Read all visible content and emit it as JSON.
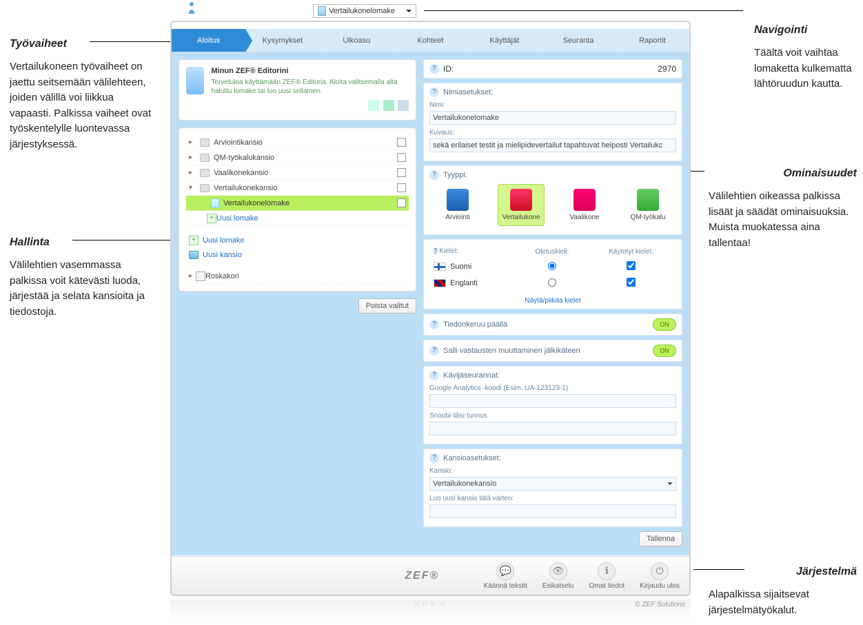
{
  "annotations": {
    "navigation": {
      "title": "Navigointi",
      "text": "Täältä voit vaihtaa lomaketta kulkematta lähtöruudun kautta."
    },
    "workphases": {
      "title": "Työvaiheet",
      "text": "Vertailukoneen työvaiheet on jaettu seitsemään välilehteen, joiden välillä voi liikkua vapaasti. Palkissa vaiheet ovat työskentelylle luontevassa järjestyksessä."
    },
    "management": {
      "title": "Hallinta",
      "text": "Välilehtien vasemmassa palkissa voit kätevästi luoda, järjestää ja selata kansioita ja tiedostoja."
    },
    "properties": {
      "title": "Ominaisuudet",
      "text": "Välilehtien oikeassa palkissa lisäät ja säädät ominaisuuksia. Muista muokatessa aina tallentaa!"
    },
    "system": {
      "title": "Järjestelmä",
      "text": "Alapalkissa sijaitsevat järjestelmätyökalut."
    }
  },
  "top_dropdown": "Vertailukonelomake",
  "tabs": [
    "Aloitus",
    "Kysymykset",
    "Ulkoasu",
    "Kohteet",
    "Käyttäjät",
    "Seuranta",
    "Raportit"
  ],
  "tabs_active_index": 0,
  "welcome": {
    "title": "Minun ZEF® Editorini",
    "text": "Tervetuloa käyttämään ZEF® Editoria. Aloita valitsemalla alta haluttu lomake tai luo uusi sellainen."
  },
  "tree": {
    "folders": [
      {
        "label": "Arviointikansio"
      },
      {
        "label": "QM-työkalukansio"
      },
      {
        "label": "Vaalikonekansio"
      },
      {
        "label": "Vertailukonekansio",
        "expanded": true,
        "children": [
          {
            "label": "Vertailukonelomake",
            "selected": true,
            "type": "file"
          },
          {
            "label": "Uusi lomake",
            "type": "new"
          }
        ]
      }
    ],
    "actions": {
      "new_form": "Uusi lomake",
      "new_folder": "Uusi kansio",
      "trash": "Roskakori"
    },
    "delete_selected": "Poista valitut"
  },
  "props": {
    "id_label": "ID:",
    "id_value": "2970",
    "name_settings": "Nimiasetukset:",
    "name_label": "Nimi:",
    "name_value": "Vertailukonelomake",
    "desc_label": "Kuvaus:",
    "desc_value": "sekä erilaiset testit ja mielipidevertailut tapahtuvat helposti Vertailukc",
    "type_label": "Tyyppi:",
    "types": [
      {
        "label": "Arviointi",
        "color": "blue"
      },
      {
        "label": "Vertailukone",
        "color": "red",
        "selected": true
      },
      {
        "label": "Vaalikone",
        "color": "pink"
      },
      {
        "label": "QM-työkalu",
        "color": "green"
      }
    ],
    "lang_header": "Kielet:",
    "lang_default": "Oletuskieli:",
    "lang_used": "Käytetyt kielet:",
    "langs": [
      {
        "name": "Suomi",
        "flag": "fi",
        "default": true,
        "used": true
      },
      {
        "name": "Englanti",
        "flag": "gb",
        "default": false,
        "used": true
      }
    ],
    "show_hide_langs": "Näytä/piilota kielet",
    "toggle1": {
      "label": "Tiedonkeruu päällä",
      "state": "ON"
    },
    "toggle2": {
      "label": "Salli vastausten muuttaminen jälkikäteen",
      "state": "ON"
    },
    "tracking_header": "Kävijäseurannat:",
    "tracking_ga_placeholder": "Google Analytics -koodi (Esim. UA-123123-1)",
    "tracking_snoobi_placeholder": "Snoobi-tilisi tunnus",
    "folder_settings": "Kansioasetukset:",
    "folder_label": "Kansio:",
    "folder_value": "Vertailukonekansio",
    "new_folder_label": "Luo uusi kansio tätä varten:",
    "save_button": "Tallenna"
  },
  "footer": {
    "logo": "ZEF®",
    "tools": [
      {
        "label": "Käännä tekstit",
        "icon": "💬"
      },
      {
        "label": "Esikatselu",
        "icon": "👁"
      },
      {
        "label": "Omat tiedot",
        "icon": "ℹ"
      },
      {
        "label": "Kirjaudu ulos",
        "icon": "⏻"
      }
    ],
    "copyright": "© ZEF Solutions"
  }
}
